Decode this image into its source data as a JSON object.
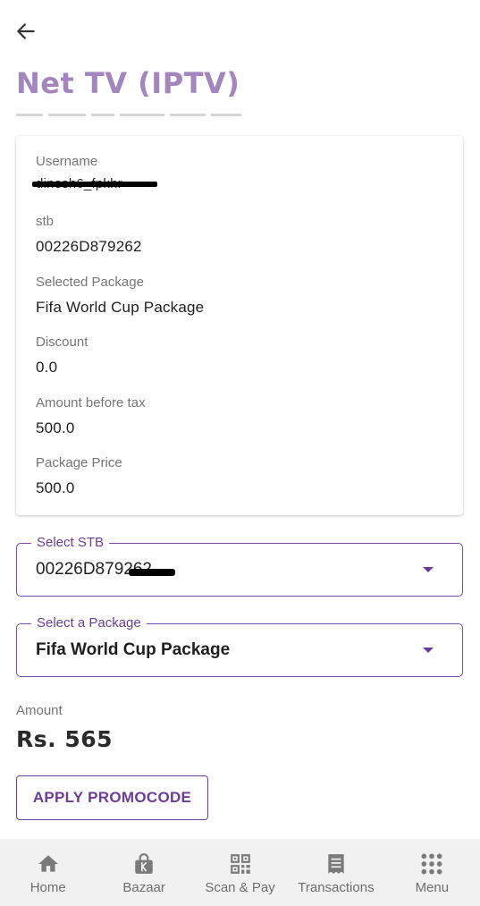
{
  "header": {
    "title": "Net TV (IPTV)"
  },
  "details": [
    {
      "label": "Username",
      "value": "dinesh6_fpkhr",
      "redacted": true
    },
    {
      "label": "stb",
      "value": "00226D879262"
    },
    {
      "label": "Selected Package",
      "value": "Fifa World Cup Package"
    },
    {
      "label": "Discount",
      "value": "0.0"
    },
    {
      "label": "Amount before tax",
      "value": "500.0"
    },
    {
      "label": "Package Price",
      "value": "500.0"
    }
  ],
  "select_stb": {
    "label": "Select STB",
    "value": "00226D879262"
  },
  "select_package": {
    "label": "Select a Package",
    "value": "Fifa World Cup Package"
  },
  "amount": {
    "label": "Amount",
    "value": "Rs. 565"
  },
  "promo": {
    "label": "APPLY PROMOCODE"
  },
  "nav": [
    {
      "label": "Home",
      "icon": "home-icon"
    },
    {
      "label": "Bazaar",
      "icon": "bag-icon"
    },
    {
      "label": "Scan & Pay",
      "icon": "qr-icon"
    },
    {
      "label": "Transactions",
      "icon": "receipt-icon"
    },
    {
      "label": "Menu",
      "icon": "grid-icon"
    }
  ],
  "colors": {
    "accent": "#6a3d97",
    "title": "#a386c0",
    "nav_bg": "#f1f1f1",
    "nav_icon": "#7a7a7a"
  }
}
